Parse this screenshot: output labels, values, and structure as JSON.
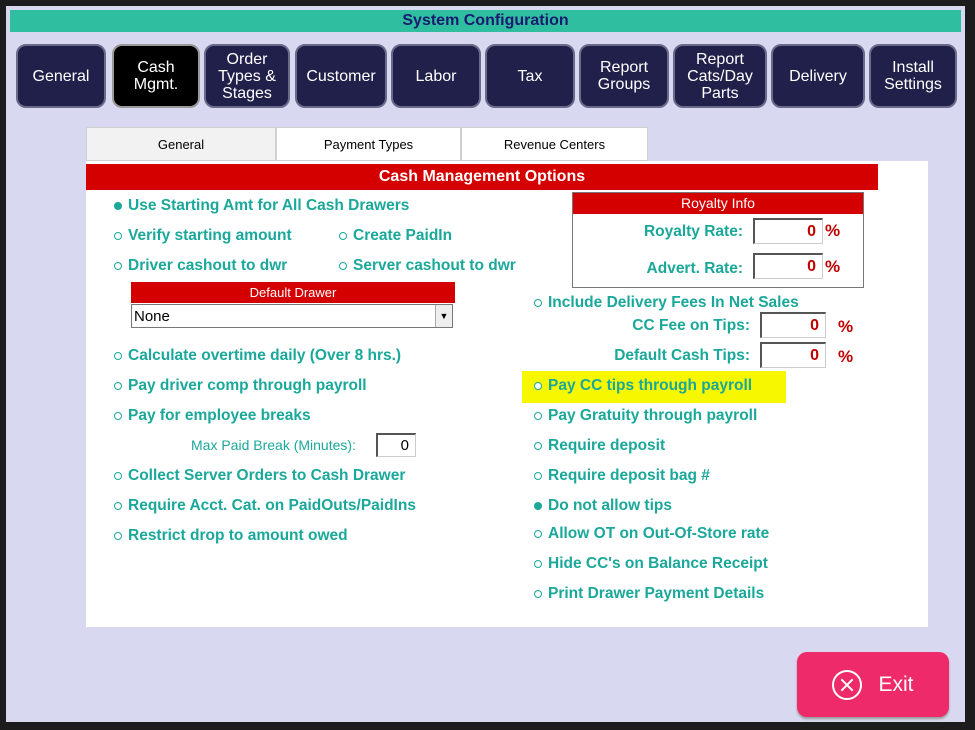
{
  "window": {
    "title": "System Configuration"
  },
  "main_tabs": [
    {
      "label": "General",
      "active": false
    },
    {
      "label": "Cash\nMgmt.",
      "active": true
    },
    {
      "label": "Order\nTypes &\nStages",
      "active": false
    },
    {
      "label": "Customer",
      "active": false
    },
    {
      "label": "Labor",
      "active": false
    },
    {
      "label": "Tax",
      "active": false
    },
    {
      "label": "Report\nGroups",
      "active": false
    },
    {
      "label": "Report\nCats/Day\nParts",
      "active": false
    },
    {
      "label": "Delivery",
      "active": false
    },
    {
      "label": "Install\nSettings",
      "active": false
    }
  ],
  "sub_tabs": [
    {
      "label": "General",
      "active": true
    },
    {
      "label": "Payment Types",
      "active": false
    },
    {
      "label": "Revenue Centers",
      "active": false
    }
  ],
  "section_title": "Cash Management Options",
  "left_options": {
    "use_starting_amt": {
      "label": "Use Starting Amt for All Cash Drawers",
      "selected": true
    },
    "verify_starting": {
      "label": "Verify starting amount",
      "selected": false
    },
    "create_paidin": {
      "label": "Create PaidIn",
      "selected": false
    },
    "driver_cashout": {
      "label": "Driver cashout to dwr",
      "selected": false
    },
    "server_cashout": {
      "label": "Server cashout to dwr",
      "selected": false
    },
    "calc_overtime": {
      "label": "Calculate overtime daily (Over 8 hrs.)",
      "selected": false
    },
    "pay_driver_comp": {
      "label": "Pay driver comp through payroll",
      "selected": false
    },
    "pay_breaks": {
      "label": "Pay for employee breaks",
      "selected": false
    },
    "collect_server_orders": {
      "label": "Collect Server Orders to Cash Drawer",
      "selected": false
    },
    "require_acct_cat": {
      "label": "Require Acct. Cat. on PaidOuts/PaidIns",
      "selected": false
    },
    "restrict_drop": {
      "label": "Restrict drop to amount owed",
      "selected": false
    }
  },
  "default_drawer": {
    "header": "Default Drawer",
    "value": "None"
  },
  "max_paid_break": {
    "label": "Max Paid Break (Minutes):",
    "value": "0"
  },
  "royalty": {
    "header": "Royalty Info",
    "royalty_rate_label": "Royalty Rate:",
    "royalty_rate_value": "0",
    "advert_rate_label": "Advert. Rate:",
    "advert_rate_value": "0",
    "pct": "%"
  },
  "right_options": {
    "include_delivery_fees": {
      "label": "Include Delivery Fees In Net Sales",
      "selected": false
    },
    "pay_cc_tips": {
      "label": "Pay CC tips through payroll",
      "selected": false,
      "highlighted": true
    },
    "pay_gratuity": {
      "label": "Pay Gratuity through payroll",
      "selected": false
    },
    "require_deposit": {
      "label": "Require deposit",
      "selected": false
    },
    "require_deposit_bag": {
      "label": "Require deposit bag #",
      "selected": false
    },
    "do_not_allow_tips": {
      "label": "Do not allow tips",
      "selected": true
    },
    "allow_ot": {
      "label": "Allow OT on Out-Of-Store rate",
      "selected": false
    },
    "hide_cc": {
      "label": "Hide CC's on Balance Receipt",
      "selected": false
    },
    "print_drawer": {
      "label": "Print Drawer Payment Details",
      "selected": false
    }
  },
  "cc_fee_tips": {
    "label": "CC Fee on Tips:",
    "value": "0",
    "pct": "%"
  },
  "default_cash_tips": {
    "label": "Default Cash Tips:",
    "value": "0",
    "pct": "%"
  },
  "exit_button": {
    "label": "Exit"
  },
  "colors": {
    "accent_teal": "#1aa89a",
    "header_red": "#d40000",
    "title_bar": "#2fbfa0",
    "exit_pink": "#ef2a6a",
    "highlight_yellow": "#f7f700"
  }
}
